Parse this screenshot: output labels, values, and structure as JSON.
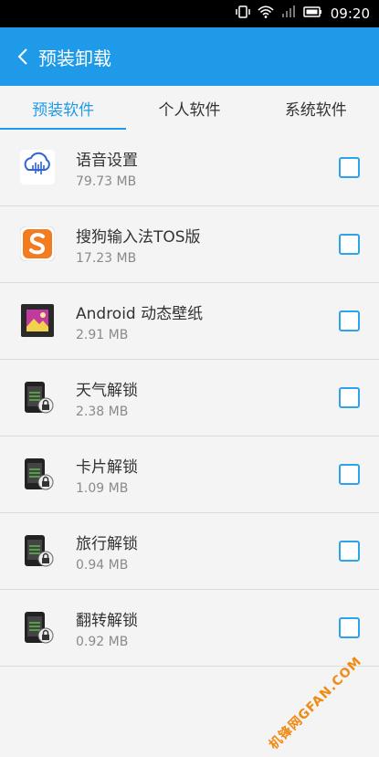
{
  "status": {
    "time": "09:20",
    "icons": [
      "vibrate-icon",
      "wifi-icon",
      "signal-icon",
      "battery-icon"
    ]
  },
  "appbar": {
    "back_label": "",
    "title": "预装卸载"
  },
  "tabs": [
    {
      "label": "预装软件",
      "active": true
    },
    {
      "label": "个人软件",
      "active": false
    },
    {
      "label": "系统软件",
      "active": false
    }
  ],
  "apps": [
    {
      "name": "语音设置",
      "size": "79.73 MB",
      "icon": "voice-settings-icon"
    },
    {
      "name": "搜狗输入法TOS版",
      "size": "17.23 MB",
      "icon": "sogou-input-icon"
    },
    {
      "name": "Android 动态壁纸",
      "size": "2.91 MB",
      "icon": "live-wallpaper-icon"
    },
    {
      "name": "天气解锁",
      "size": "2.38 MB",
      "icon": "lock-phone-icon"
    },
    {
      "name": "卡片解锁",
      "size": "1.09 MB",
      "icon": "lock-phone-icon"
    },
    {
      "name": "旅行解锁",
      "size": "0.94 MB",
      "icon": "lock-phone-icon"
    },
    {
      "name": "翻转解锁",
      "size": "0.92 MB",
      "icon": "lock-phone-icon"
    }
  ],
  "colors": {
    "accent": "#1f9ae8",
    "background": "#f4f4f4"
  },
  "watermark": "机锋网GFAN.COM"
}
